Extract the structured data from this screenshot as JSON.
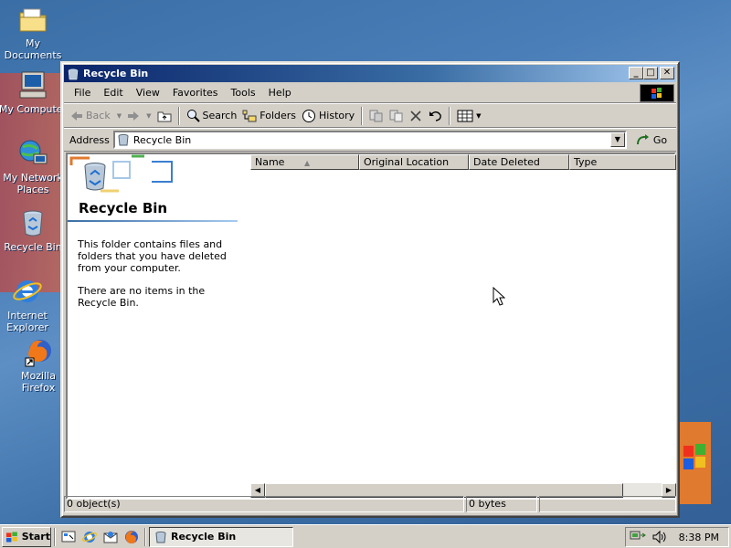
{
  "desktop": {
    "icons": [
      {
        "label": "My Documents"
      },
      {
        "label": "My Computer"
      },
      {
        "label": "My Network Places"
      },
      {
        "label": "Recycle Bin"
      },
      {
        "label": "Internet Explorer"
      },
      {
        "label": "Mozilla Firefox"
      }
    ]
  },
  "window": {
    "title": "Recycle Bin",
    "menu": [
      "File",
      "Edit",
      "View",
      "Favorites",
      "Tools",
      "Help"
    ],
    "toolbar": {
      "back": "Back",
      "search": "Search",
      "folders": "Folders",
      "history": "History"
    },
    "address": {
      "label": "Address",
      "value": "Recycle Bin",
      "go": "Go"
    },
    "left_pane": {
      "title": "Recycle Bin",
      "desc": "This folder contains files and folders that you have deleted from your computer.",
      "empty": "There are no items in the Recycle Bin."
    },
    "columns": [
      "Name",
      "Original Location",
      "Date Deleted",
      "Type"
    ],
    "status": {
      "objects": "0 object(s)",
      "size": "0 bytes"
    }
  },
  "taskbar": {
    "start": "Start",
    "task": "Recycle Bin",
    "clock": "8:38 PM"
  }
}
